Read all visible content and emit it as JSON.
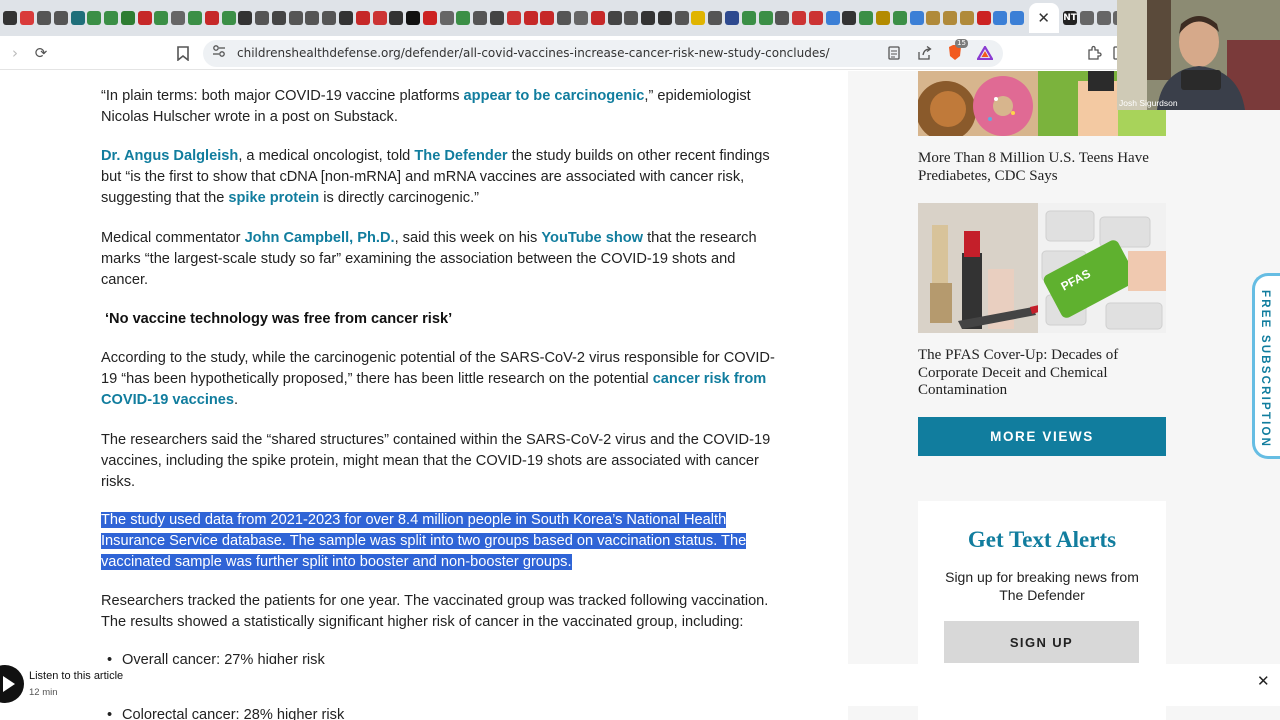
{
  "browser": {
    "tabs": {
      "favicon_colors": [
        "#333333",
        "#d93a3a",
        "#555555",
        "#555555",
        "#1f6f7a",
        "#3b8f46",
        "#3b8f46",
        "#2e7d32",
        "#c62828",
        "#3b8f46",
        "#666666",
        "#3b8f46",
        "#c62828",
        "#3b8f46",
        "#333333",
        "#555555",
        "#444444",
        "#555555",
        "#555555",
        "#555555",
        "#333333",
        "#c62828",
        "#cc3333",
        "#333333",
        "#111111",
        "#cc2222",
        "#666666",
        "#3b8f46",
        "#555555",
        "#444444",
        "#cc3333",
        "#c62828",
        "#c62828",
        "#555555",
        "#666666",
        "#c62828",
        "#444444",
        "#555555",
        "#333333",
        "#333333",
        "#555555",
        "#e0b400",
        "#555555",
        "#2e4a8f",
        "#3b8f46",
        "#3b8f46",
        "#555555",
        "#cc3333",
        "#cc3333",
        "#3b7fd6",
        "#333333",
        "#3b8f46",
        "#b38b00",
        "#3b8f46",
        "#3b7fd6",
        "#b08a3a",
        "#b08a3a",
        "#b08a3a",
        "#cc2222",
        "#3b7fd6",
        "#3b7fd6"
      ],
      "active_close": "✕",
      "after_colors": [
        "#222222",
        "#666666",
        "#666666",
        "#666666",
        "#666666",
        "#666666",
        "#2e7d32"
      ],
      "active_label": "NT"
    },
    "toolbar": {
      "back_icon": "›",
      "reload_icon": "⟳",
      "bookmark_icon": "🔖",
      "site_info_icon": "⚙",
      "url": "childrenshealthdefense.org/defender/all-covid-vaccines-increase-cancer-risk-new-study-concludes/",
      "reader_icon": "▤",
      "share_icon": "↗",
      "shield_badge": "15",
      "extensions_icon": "⧉"
    }
  },
  "article": {
    "p1": {
      "before": "“In plain terms: both major COVID-19 vaccine platforms ",
      "link": "appear to be carcinogenic",
      "after": ",” epidemiologist Nicolas Hulscher wrote in a post on Substack."
    },
    "p2": {
      "link1": "Dr. Angus Dalgleish",
      "t1": ", a medical oncologist, told ",
      "link2": "The Defender",
      "t2": " the study builds on other recent findings but “is the first to show that cDNA [non-mRNA] and mRNA vaccines are associated with cancer risk, suggesting that the ",
      "link3": "spike protein",
      "t3": " is directly carcinogenic.”"
    },
    "p3": {
      "t1": "Medical commentator ",
      "link1": "John Campbell, Ph.D.",
      "t2": ", said this week on his ",
      "link2": "YouTube show",
      "t3": " that the research marks “the largest-scale study so far” examining the association between the COVID-19 shots and cancer."
    },
    "subhead": "‘No vaccine technology was free from cancer risk’",
    "p4": {
      "t1": "According to the study, while the carcinogenic potential of the SARS-CoV-2 virus responsible for COVID-19 “has been hypothetically proposed,” there has been little research on the potential ",
      "link1": "cancer risk from COVID-19 vaccines",
      "t2": "."
    },
    "p5": "The researchers said the “shared structures” contained within the SARS-CoV-2 virus and the COVID-19 vaccines, including the spike protein, might mean that the COVID-19 shots are associated with cancer risks.",
    "p6_highlighted": "The study used data from 2021-2023 for over 8.4 million people in South Korea’s National Health Insurance Service database. The sample was split into two groups based on vaccination status. The vaccinated sample was further split into booster and non-booster groups.",
    "p7": "Researchers tracked the patients for one year. The vaccinated group was tracked following vaccination. The results showed a statistically significant higher risk of cancer in the vaccinated group, including:",
    "bullets": [
      "Overall cancer: 27% higher risk",
      "Colorectal cancer: 28% higher risk"
    ]
  },
  "listen": {
    "title": "Listen to this article",
    "duration": "12 min",
    "close_icon": "✕"
  },
  "sidebar": {
    "story1_title": "More Than 8 Million U.S. Teens Have Prediabetes, CDC Says",
    "story2_title": "The PFAS Cover-Up: Decades of Corporate Deceit and Chemical Contamination",
    "story2_key_text": "PFAS",
    "more_views": "MORE VIEWS",
    "alerts_title": "Get Text Alerts",
    "alerts_text": "Sign up for breaking news from The Defender",
    "signup": "SIGN UP",
    "free_subscription": "FREE SUBSCRIPTION"
  },
  "webcam": {
    "name": "Josh Sigurdson"
  }
}
